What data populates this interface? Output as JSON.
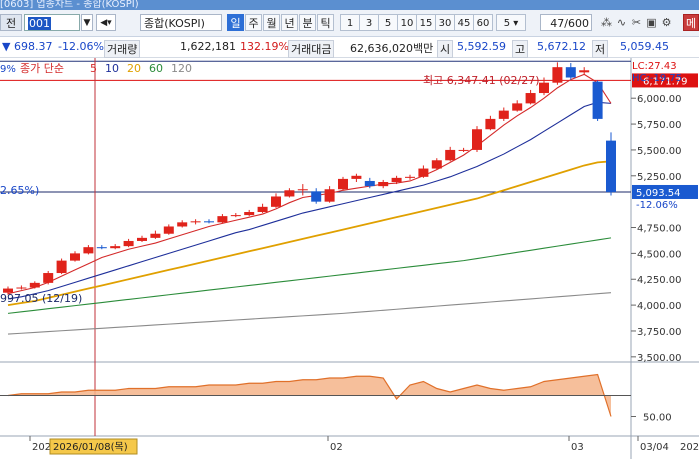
{
  "window": {
    "title": "[0603] 업종차트 - 종합(KOSPI)"
  },
  "toolbar": {
    "label": "전",
    "code": "001",
    "search_icon": "search-icon",
    "sound_icon": "speaker-icon",
    "index_name": "종합(KOSPI)",
    "period_buttons": [
      "일",
      "주",
      "월",
      "년",
      "분",
      "틱"
    ],
    "active_period": "일",
    "interval_buttons": [
      "1",
      "3",
      "5",
      "10",
      "15",
      "30",
      "45",
      "60"
    ],
    "interval_select": "5",
    "counter": "47/600",
    "right_label": "메"
  },
  "quote": {
    "price": "698.37",
    "change_pct": "-12.06%",
    "volume_label": "거래량",
    "volume": "1,622,181",
    "volume_ratio": "132.19%",
    "amount_label": "거래대금",
    "amount": "62,636,020백만",
    "open_label": "시",
    "open": "5,592.59",
    "high_label": "고",
    "high": "5,672.12",
    "low_label": "저",
    "low": "5,059.45"
  },
  "chart": {
    "legend_prefix": "종가 단순",
    "legend_items": [
      {
        "label": "5",
        "color": "#d42a2a"
      },
      {
        "label": "10",
        "color": "#1e2f9a"
      },
      {
        "label": "20",
        "color": "#e0a000"
      },
      {
        "label": "60",
        "color": "#2b8c3a"
      },
      {
        "label": "120",
        "color": "#8a8a8a"
      }
    ],
    "legend_left_fragment": "9%",
    "max_label": "최고 6,347.41 (02/27)",
    "min_label": "997.05 (12/19)",
    "pct_left_fragment": "2.65%)",
    "lc_label": "LC:27.43",
    "hc_label": "HC:-19.75",
    "price_tag_top": "6,171.79",
    "price_tag_current": "5,093.54",
    "current_change": "-12.06%",
    "y_ticks": [
      "6,000.00",
      "5,750.00",
      "5,500.00",
      "5,250.00",
      "4,750.00",
      "4,500.00",
      "4,250.00",
      "4,000.00",
      "3,750.00",
      "3,500.00"
    ],
    "sub_tick": "50.00",
    "x_labels": [
      "202",
      "02",
      "03",
      "03/04"
    ],
    "cursor_date": "2026/01/08(목)",
    "x_right_label": "202",
    "colors": {
      "up": "#e0231b",
      "down": "#1a5ad0",
      "grid": "#d9dde4"
    }
  },
  "chart_data": {
    "type": "candlestick",
    "y_range": [
      3450,
      6350
    ],
    "candles": [
      {
        "o": 4120,
        "c": 4160,
        "h": 4180,
        "l": 4100
      },
      {
        "o": 4165,
        "c": 4170,
        "h": 4190,
        "l": 4150
      },
      {
        "o": 4170,
        "c": 4215,
        "h": 4230,
        "l": 4160
      },
      {
        "o": 4215,
        "c": 4310,
        "h": 4330,
        "l": 4200
      },
      {
        "o": 4310,
        "c": 4430,
        "h": 4450,
        "l": 4300
      },
      {
        "o": 4430,
        "c": 4500,
        "h": 4520,
        "l": 4420
      },
      {
        "o": 4500,
        "c": 4560,
        "h": 4580,
        "l": 4490
      },
      {
        "o": 4560,
        "c": 4550,
        "h": 4580,
        "l": 4540
      },
      {
        "o": 4550,
        "c": 4570,
        "h": 4590,
        "l": 4540
      },
      {
        "o": 4570,
        "c": 4620,
        "h": 4640,
        "l": 4560
      },
      {
        "o": 4620,
        "c": 4650,
        "h": 4670,
        "l": 4610
      },
      {
        "o": 4650,
        "c": 4690,
        "h": 4720,
        "l": 4640
      },
      {
        "o": 4690,
        "c": 4760,
        "h": 4780,
        "l": 4680
      },
      {
        "o": 4760,
        "c": 4800,
        "h": 4820,
        "l": 4750
      },
      {
        "o": 4800,
        "c": 4810,
        "h": 4830,
        "l": 4780
      },
      {
        "o": 4810,
        "c": 4800,
        "h": 4830,
        "l": 4790
      },
      {
        "o": 4800,
        "c": 4860,
        "h": 4880,
        "l": 4790
      },
      {
        "o": 4860,
        "c": 4870,
        "h": 4890,
        "l": 4850
      },
      {
        "o": 4870,
        "c": 4900,
        "h": 4920,
        "l": 4860
      },
      {
        "o": 4900,
        "c": 4950,
        "h": 4980,
        "l": 4890
      },
      {
        "o": 4950,
        "c": 5050,
        "h": 5080,
        "l": 4940
      },
      {
        "o": 5050,
        "c": 5110,
        "h": 5130,
        "l": 5040
      },
      {
        "o": 5110,
        "c": 5120,
        "h": 5170,
        "l": 5060
      },
      {
        "o": 5100,
        "c": 5000,
        "h": 5130,
        "l": 4980
      },
      {
        "o": 5000,
        "c": 5120,
        "h": 5150,
        "l": 4990
      },
      {
        "o": 5120,
        "c": 5220,
        "h": 5240,
        "l": 5110
      },
      {
        "o": 5220,
        "c": 5250,
        "h": 5270,
        "l": 5190
      },
      {
        "o": 5200,
        "c": 5150,
        "h": 5230,
        "l": 5130
      },
      {
        "o": 5150,
        "c": 5190,
        "h": 5210,
        "l": 5130
      },
      {
        "o": 5190,
        "c": 5230,
        "h": 5250,
        "l": 5170
      },
      {
        "o": 5230,
        "c": 5240,
        "h": 5260,
        "l": 5210
      },
      {
        "o": 5240,
        "c": 5320,
        "h": 5350,
        "l": 5230
      },
      {
        "o": 5320,
        "c": 5400,
        "h": 5420,
        "l": 5310
      },
      {
        "o": 5400,
        "c": 5500,
        "h": 5530,
        "l": 5390
      },
      {
        "o": 5500,
        "c": 5500,
        "h": 5520,
        "l": 5480
      },
      {
        "o": 5500,
        "c": 5700,
        "h": 5730,
        "l": 5480
      },
      {
        "o": 5700,
        "c": 5800,
        "h": 5830,
        "l": 5690
      },
      {
        "o": 5800,
        "c": 5880,
        "h": 5910,
        "l": 5780
      },
      {
        "o": 5880,
        "c": 5950,
        "h": 5980,
        "l": 5870
      },
      {
        "o": 5950,
        "c": 6050,
        "h": 6080,
        "l": 5940
      },
      {
        "o": 6050,
        "c": 6150,
        "h": 6200,
        "l": 6030
      },
      {
        "o": 6150,
        "c": 6300,
        "h": 6347,
        "l": 6130
      },
      {
        "o": 6300,
        "c": 6200,
        "h": 6340,
        "l": 6180
      },
      {
        "o": 6250,
        "c": 6270,
        "h": 6300,
        "l": 6230
      },
      {
        "o": 6160,
        "c": 5800,
        "h": 6170,
        "l": 5780
      },
      {
        "o": 5590,
        "c": 5093,
        "h": 5670,
        "l": 5059
      }
    ],
    "ma5": [
      4110,
      4140,
      4170,
      4220,
      4280,
      4340,
      4400,
      4460,
      4500,
      4540,
      4570,
      4600,
      4640,
      4680,
      4720,
      4760,
      4790,
      4820,
      4850,
      4880,
      4930,
      4990,
      5040,
      5060,
      5080,
      5110,
      5130,
      5150,
      5170,
      5180,
      5200,
      5250,
      5310,
      5380,
      5450,
      5540,
      5640,
      5740,
      5830,
      5910,
      6000,
      6100,
      6180,
      6230,
      6150,
      5950
    ],
    "ma10": [
      4060,
      4080,
      4110,
      4140,
      4180,
      4220,
      4260,
      4300,
      4340,
      4380,
      4420,
      4460,
      4500,
      4540,
      4580,
      4620,
      4660,
      4700,
      4730,
      4770,
      4810,
      4850,
      4890,
      4920,
      4950,
      4980,
      5010,
      5040,
      5070,
      5100,
      5130,
      5160,
      5200,
      5240,
      5290,
      5340,
      5400,
      5460,
      5530,
      5600,
      5680,
      5760,
      5840,
      5920,
      5960,
      5950
    ],
    "ma20": [
      4000,
      4020,
      4040,
      4070,
      4100,
      4130,
      4160,
      4190,
      4220,
      4250,
      4280,
      4310,
      4340,
      4370,
      4400,
      4430,
      4460,
      4490,
      4520,
      4550,
      4580,
      4610,
      4640,
      4670,
      4700,
      4730,
      4760,
      4790,
      4820,
      4850,
      4880,
      4910,
      4940,
      4970,
      5000,
      5030,
      5070,
      5110,
      5150,
      5190,
      5230,
      5270,
      5310,
      5350,
      5380,
      5390
    ],
    "ma60": [
      3920,
      3935,
      3950,
      3965,
      3980,
      3995,
      4010,
      4025,
      4040,
      4055,
      4070,
      4085,
      4100,
      4115,
      4130,
      4145,
      4160,
      4175,
      4190,
      4205,
      4220,
      4235,
      4250,
      4265,
      4280,
      4295,
      4310,
      4325,
      4340,
      4355,
      4370,
      4385,
      4400,
      4415,
      4430,
      4450,
      4470,
      4490,
      4510,
      4530,
      4550,
      4570,
      4590,
      4610,
      4630,
      4650
    ],
    "ma120": [
      3720,
      3728,
      3736,
      3744,
      3752,
      3760,
      3768,
      3776,
      3784,
      3792,
      3800,
      3808,
      3816,
      3824,
      3832,
      3840,
      3848,
      3856,
      3864,
      3872,
      3880,
      3888,
      3896,
      3904,
      3912,
      3920,
      3930,
      3940,
      3950,
      3960,
      3970,
      3980,
      3990,
      4000,
      4010,
      4020,
      4030,
      4040,
      4050,
      4060,
      4070,
      4080,
      4090,
      4100,
      4110,
      4120
    ],
    "osc": [
      62,
      63,
      63,
      63,
      64,
      64,
      65,
      65,
      65,
      66,
      66,
      66,
      67,
      67,
      67,
      68,
      68,
      68,
      69,
      69,
      70,
      70,
      71,
      71,
      72,
      72,
      73,
      73,
      72,
      60,
      68,
      70,
      66,
      64,
      66,
      68,
      66,
      65,
      66,
      67,
      70,
      71,
      72,
      73,
      74,
      50
    ]
  }
}
